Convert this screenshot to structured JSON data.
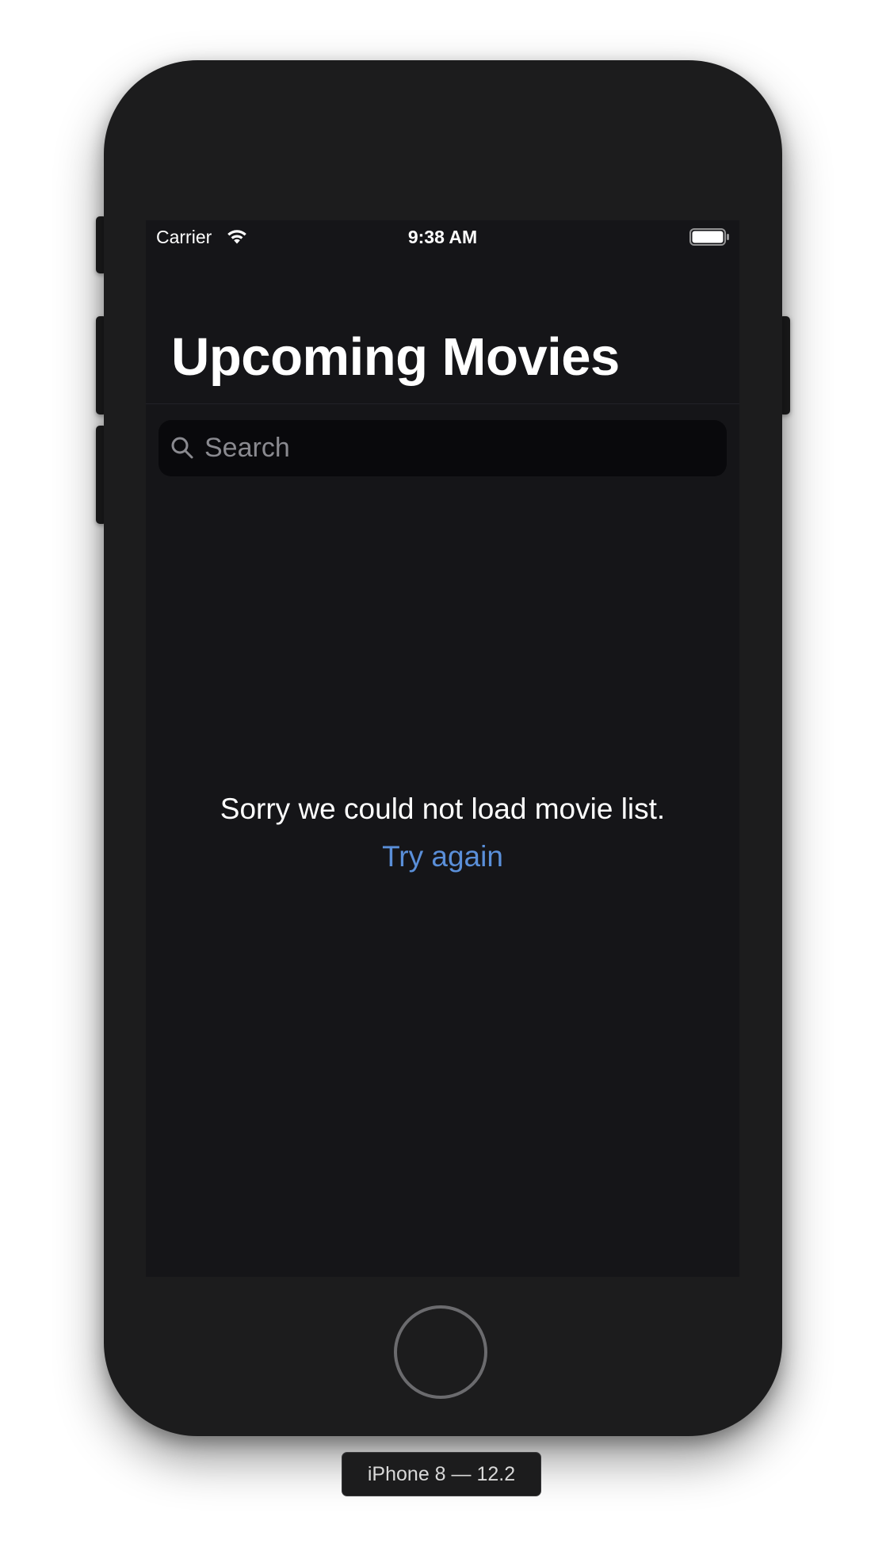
{
  "status_bar": {
    "carrier": "Carrier",
    "time": "9:38 AM"
  },
  "navigation": {
    "title": "Upcoming Movies"
  },
  "search": {
    "placeholder": "Search",
    "value": ""
  },
  "content": {
    "error_message": "Sorry we could not load movie list.",
    "retry_label": "Try again"
  },
  "device": {
    "label": "iPhone 8 — 12.2"
  },
  "colors": {
    "background": "#151518",
    "accent": "#5a8fd9",
    "text": "#ffffff",
    "placeholder": "#8a8a90"
  },
  "icons": {
    "wifi": "wifi-icon",
    "battery": "battery-icon",
    "search": "search-icon"
  }
}
